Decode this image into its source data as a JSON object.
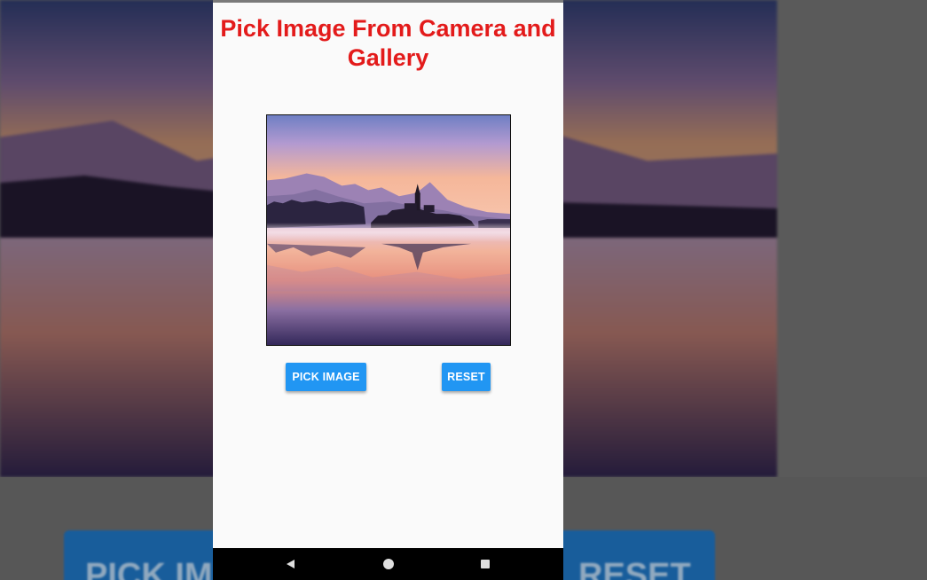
{
  "app": {
    "title": "Pick Image From Camera and Gallery"
  },
  "image": {
    "icon": "landscape-photo-icon",
    "scene": "lake-castle-sunset"
  },
  "buttons": {
    "pick_label": "PICK IMAGE",
    "reset_label": "RESET"
  },
  "background": {
    "left_button_fragment": "PICK IM",
    "right_button_fragment": "RESET"
  },
  "navigation": {
    "back_icon": "back-triangle-icon",
    "home_icon": "home-circle-icon",
    "recents_icon": "recents-square-icon"
  },
  "colors": {
    "title": "#e31b1b",
    "button": "#2196f3",
    "surface": "#fafafa",
    "navbar": "#000000"
  }
}
